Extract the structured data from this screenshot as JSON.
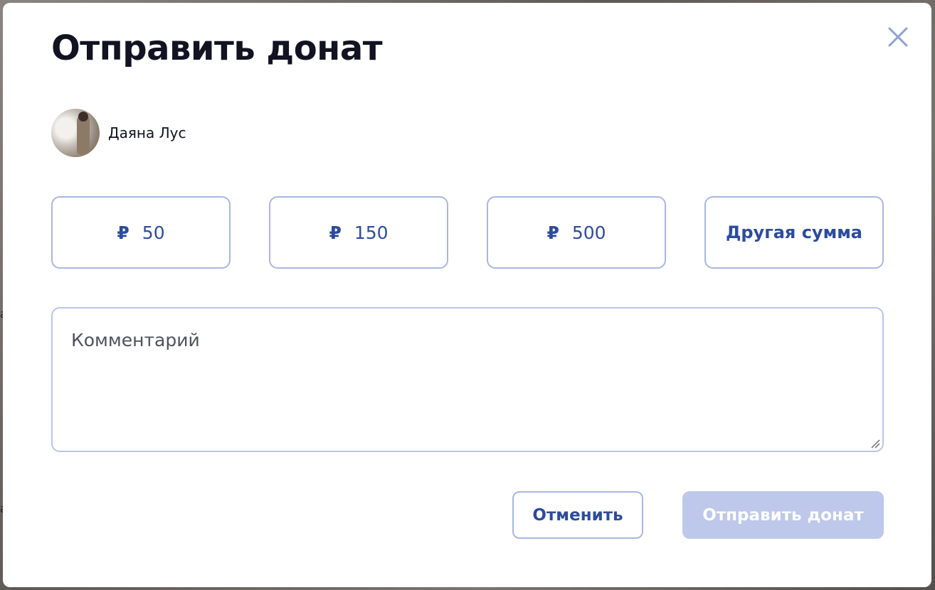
{
  "modal": {
    "title": "Отправить донат",
    "close_icon": "close-icon"
  },
  "recipient": {
    "name": "Даяна Лус",
    "avatar_icon": "avatar"
  },
  "amounts": [
    {
      "currency_symbol": "₽",
      "value": "50"
    },
    {
      "currency_symbol": "₽",
      "value": "150"
    },
    {
      "currency_symbol": "₽",
      "value": "500"
    }
  ],
  "other_amount_label": "Другая сумма",
  "comment": {
    "placeholder": "Комментарий",
    "value": ""
  },
  "actions": {
    "cancel_label": "Отменить",
    "send_label": "Отправить донат",
    "send_enabled": false
  },
  "colors": {
    "accent": "#2c4c9c",
    "border": "#a8b6e2",
    "disabled_button": "#bdc8ea",
    "title": "#111322"
  }
}
